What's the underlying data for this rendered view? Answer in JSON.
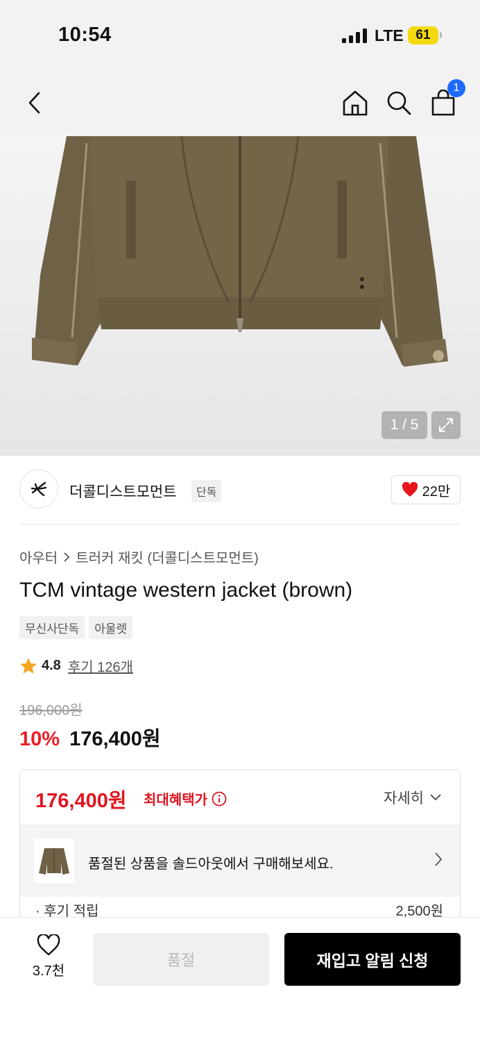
{
  "status_bar": {
    "time": "10:54",
    "network": "LTE",
    "battery": "61"
  },
  "nav": {
    "cart_count": "1"
  },
  "gallery": {
    "counter": "1 / 5",
    "image_alt": "brown jacket photo"
  },
  "brand": {
    "name": "더콜디스트모먼트",
    "tag": "단독",
    "likes": "22만"
  },
  "product": {
    "breadcrumb": [
      "아우터",
      "트러커 재킷 (더콜디스트모먼트)"
    ],
    "title": "TCM vintage western jacket (brown)",
    "tags": [
      "무신사단독",
      "아울렛"
    ],
    "rating": "4.8",
    "reviews": "후기 126개",
    "original_price": "196,000원",
    "discount": "10%",
    "sale_price": "176,400원"
  },
  "benefit": {
    "price": "176,400원",
    "label": "최대혜택가",
    "detail": "자세히",
    "soldout_message": "품절된 상품을 솔드아웃에서 구매해보세요.",
    "reward_label": "· 후기 적립",
    "reward_value": "2,500원"
  },
  "bottom": {
    "wish_count": "3.7천",
    "soldout_label": "품절",
    "restock_label": "재입고 알림 신청"
  },
  "colors": {
    "accent_red": "#ee1c25",
    "cart_badge": "#1f6bff",
    "primary_button": "#000000",
    "battery": "#f5d90f"
  }
}
